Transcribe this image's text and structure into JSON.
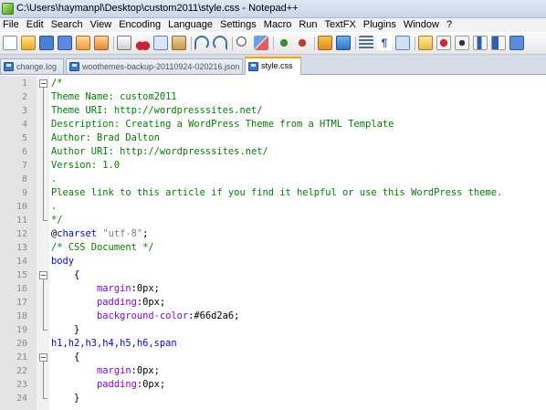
{
  "window": {
    "title": "C:\\Users\\haymanpl\\Desktop\\custom2011\\style.css - Notepad++"
  },
  "menu": [
    "File",
    "Edit",
    "Search",
    "View",
    "Encoding",
    "Language",
    "Settings",
    "Macro",
    "Run",
    "TextFX",
    "Plugins",
    "Window",
    "?"
  ],
  "toolbar": {
    "buttons": [
      "new-file",
      "open-file",
      "save",
      "save-all",
      "close",
      "close-all",
      "print",
      "cut",
      "copy",
      "paste",
      "undo",
      "redo",
      "find",
      "replace",
      "zoom-in",
      "zoom-out",
      "sync-vertical",
      "sync-horizontal",
      "word-wrap",
      "show-all-chars",
      "indent-guide",
      "user-defined-lang",
      "record-macro",
      "stop-record",
      "play-macro",
      "run-macro-multiple",
      "save-macro"
    ]
  },
  "tabs": [
    {
      "label": "change.log",
      "active": false
    },
    {
      "label": "woothemes-backup-20110924-020216.json",
      "active": false
    },
    {
      "label": "style.css",
      "active": true
    }
  ],
  "editor": {
    "lines": [
      {
        "n": "1",
        "fold": "open",
        "segments": [
          {
            "t": "/*",
            "k": "comment"
          }
        ]
      },
      {
        "n": "2",
        "fold": "line",
        "segments": [
          {
            "t": "Theme Name: custom2011",
            "k": "comment"
          }
        ]
      },
      {
        "n": "3",
        "fold": "line",
        "segments": [
          {
            "t": "Theme URI: http://wordpresssites.net/",
            "k": "comment"
          }
        ]
      },
      {
        "n": "4",
        "fold": "line",
        "segments": [
          {
            "t": "Description: Creating a WordPress Theme from a HTML Template",
            "k": "comment"
          }
        ]
      },
      {
        "n": "5",
        "fold": "line",
        "segments": [
          {
            "t": "Author: Brad Dalton",
            "k": "comment"
          }
        ]
      },
      {
        "n": "6",
        "fold": "line",
        "segments": [
          {
            "t": "Author URI: http://wordpresssites.net/",
            "k": "comment"
          }
        ]
      },
      {
        "n": "7",
        "fold": "line",
        "segments": [
          {
            "t": "Version: 1.0",
            "k": "comment"
          }
        ]
      },
      {
        "n": "8",
        "fold": "line",
        "segments": [
          {
            "t": ".",
            "k": "comment"
          }
        ]
      },
      {
        "n": "9",
        "fold": "line",
        "segments": [
          {
            "t": "Please link to this article if you find it helpful or use this WordPress theme.",
            "k": "comment"
          }
        ]
      },
      {
        "n": "10",
        "fold": "line",
        "segments": [
          {
            "t": ".",
            "k": "comment"
          }
        ]
      },
      {
        "n": "11",
        "fold": "end",
        "segments": [
          {
            "t": "*/",
            "k": "comment"
          }
        ]
      },
      {
        "n": "12",
        "fold": "",
        "segments": [
          {
            "t": "@",
            "k": "at"
          },
          {
            "t": "charset",
            "k": "atname"
          },
          {
            "t": " ",
            "k": "val"
          },
          {
            "t": "\"utf-8\"",
            "k": "str"
          },
          {
            "t": ";",
            "k": "val"
          }
        ]
      },
      {
        "n": "13",
        "fold": "",
        "segments": [
          {
            "t": "/* CSS Document */",
            "k": "comment"
          }
        ]
      },
      {
        "n": "14",
        "fold": "",
        "segments": [
          {
            "t": "body",
            "k": "tag"
          }
        ]
      },
      {
        "n": "15",
        "fold": "open",
        "segments": [
          {
            "t": "    {",
            "k": "val"
          }
        ]
      },
      {
        "n": "16",
        "fold": "line",
        "segments": [
          {
            "t": "        ",
            "k": "val"
          },
          {
            "t": "margin",
            "k": "prop"
          },
          {
            "t": ":0px;",
            "k": "val"
          }
        ]
      },
      {
        "n": "17",
        "fold": "line",
        "segments": [
          {
            "t": "        ",
            "k": "val"
          },
          {
            "t": "padding",
            "k": "prop"
          },
          {
            "t": ":0px;",
            "k": "val"
          }
        ]
      },
      {
        "n": "18",
        "fold": "line",
        "segments": [
          {
            "t": "        ",
            "k": "val"
          },
          {
            "t": "background-color",
            "k": "prop"
          },
          {
            "t": ":#66d2a6;",
            "k": "val"
          }
        ]
      },
      {
        "n": "19",
        "fold": "end",
        "segments": [
          {
            "t": "    }",
            "k": "val"
          }
        ]
      },
      {
        "n": "20",
        "fold": "",
        "segments": [
          {
            "t": "h1,h2,h3,h4,h5,h6,span",
            "k": "tag"
          }
        ]
      },
      {
        "n": "21",
        "fold": "open",
        "segments": [
          {
            "t": "    {",
            "k": "val"
          }
        ]
      },
      {
        "n": "22",
        "fold": "line",
        "segments": [
          {
            "t": "        ",
            "k": "val"
          },
          {
            "t": "margin",
            "k": "prop"
          },
          {
            "t": ":0px;",
            "k": "val"
          }
        ]
      },
      {
        "n": "23",
        "fold": "line",
        "segments": [
          {
            "t": "        ",
            "k": "val"
          },
          {
            "t": "padding",
            "k": "prop"
          },
          {
            "t": ":0px;",
            "k": "val"
          }
        ]
      },
      {
        "n": "24",
        "fold": "end",
        "segments": [
          {
            "t": "    }",
            "k": "val"
          }
        ]
      }
    ]
  }
}
